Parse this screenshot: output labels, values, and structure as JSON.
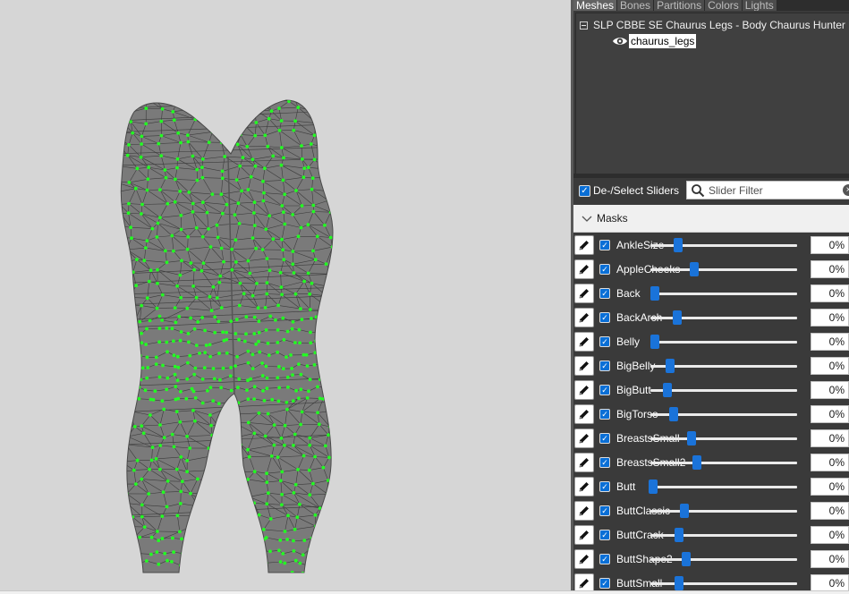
{
  "tabs": [
    "Meshes",
    "Bones",
    "Partitions",
    "Colors",
    "Lights"
  ],
  "active_tab": "Meshes",
  "mesh_tree": {
    "root_label": "SLP CBBE SE Chaurus Legs - Body Chaurus Hunter",
    "child_label": "chaurus_legs",
    "child_icon": "eye-icon"
  },
  "slider_toolbar": {
    "deselect_label": "De-/Select Sliders",
    "filter_placeholder": "Slider Filter"
  },
  "masks_label": "Masks",
  "colors": {
    "accent": "#1a73d9",
    "vertex": "#22ff22",
    "mesh": "#7a7a7a",
    "panel": "#3a3a3a"
  },
  "sliders": [
    {
      "name": "AnkleSize",
      "value": "0%",
      "level": 0
    },
    {
      "name": "AppleCheeks",
      "value": "0%",
      "level": 0
    },
    {
      "name": "Back",
      "value": "0%",
      "level": 0
    },
    {
      "name": "BackArch",
      "value": "0%",
      "level": 0
    },
    {
      "name": "Belly",
      "value": "0%",
      "level": 0
    },
    {
      "name": "BigBelly",
      "value": "0%",
      "level": 0
    },
    {
      "name": "BigButt",
      "value": "0%",
      "level": 0
    },
    {
      "name": "BigTorso",
      "value": "0%",
      "level": 0
    },
    {
      "name": "BreastsSmall",
      "value": "0%",
      "level": 0
    },
    {
      "name": "BreastsSmall2",
      "value": "0%",
      "level": 0
    },
    {
      "name": "Butt",
      "value": "0%",
      "level": 0
    },
    {
      "name": "ButtClassic",
      "value": "0%",
      "level": 0
    },
    {
      "name": "ButtCrack",
      "value": "0%",
      "level": 0
    },
    {
      "name": "ButtShape2",
      "value": "0%",
      "level": 0
    },
    {
      "name": "ButtSmall",
      "value": "0%",
      "level": 0
    }
  ]
}
